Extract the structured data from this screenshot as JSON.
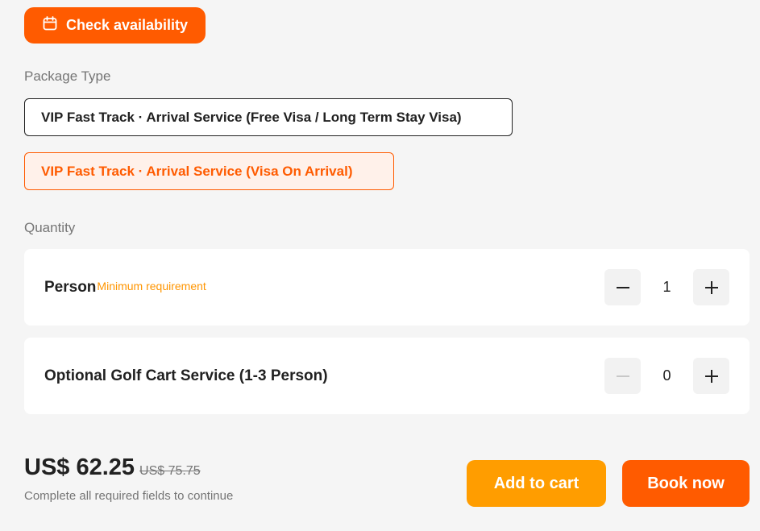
{
  "availability": {
    "button_label": "Check availability",
    "icon": "calendar-icon"
  },
  "package_type": {
    "label": "Package Type",
    "options": [
      {
        "label": "VIP Fast Track · Arrival Service (Free Visa / Long Term Stay Visa)",
        "selected": false
      },
      {
        "label": "VIP Fast Track · Arrival Service (Visa On Arrival)",
        "selected": true
      }
    ]
  },
  "quantity": {
    "label": "Quantity",
    "items": [
      {
        "title": "Person",
        "note": "Minimum requirement",
        "value": "1",
        "decrement_enabled": true
      },
      {
        "title": "Optional Golf Cart Service (1-3 Person)",
        "note": "",
        "value": "0",
        "decrement_enabled": false
      }
    ]
  },
  "pricing": {
    "current": "US$ 62.25",
    "original": "US$ 75.75",
    "note": "Complete all required fields to continue"
  },
  "actions": {
    "add_to_cart": "Add to cart",
    "book_now": "Book now"
  },
  "colors": {
    "primary": "#ff5b00",
    "secondary": "#ff9d00",
    "accent_text": "#ff9500",
    "selected_bg": "#fff1ea"
  }
}
